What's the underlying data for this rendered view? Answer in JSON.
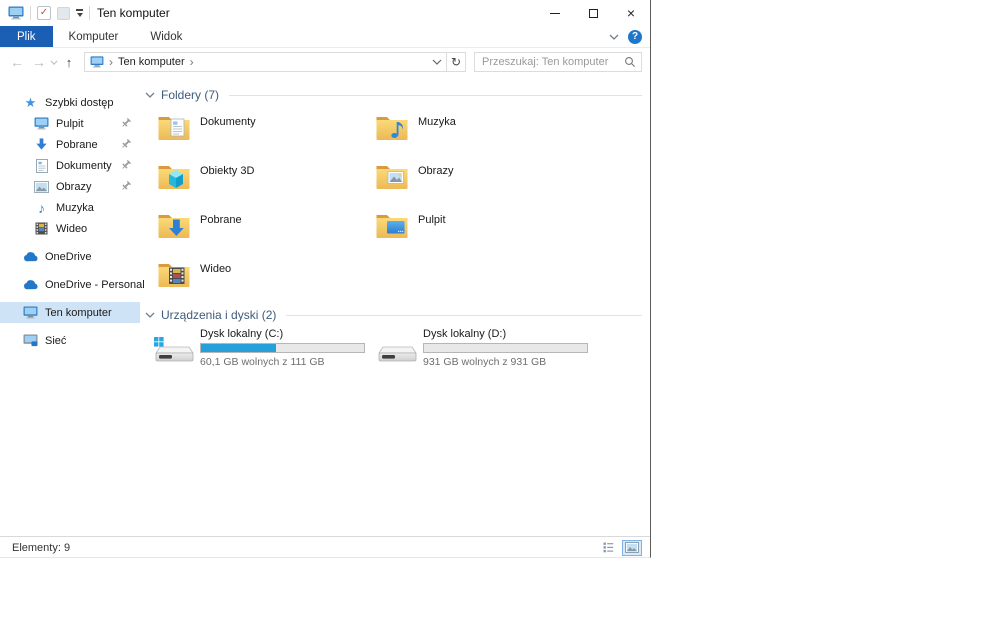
{
  "colors": {
    "accent": "#1b5fb5",
    "capacity_fill": "#26a0da",
    "selection_bg": "#cfe3f6"
  },
  "window": {
    "title": "Ten komputer"
  },
  "icons": {
    "back": "←",
    "forward": "→",
    "up": "↑",
    "refresh": "↻",
    "crumb_sep": "›",
    "help": "?",
    "close": "×",
    "star": "★",
    "music_note": "♪",
    "check": "✓"
  },
  "ribbon": {
    "tabs": [
      {
        "label": "Plik"
      },
      {
        "label": "Komputer"
      },
      {
        "label": "Widok"
      }
    ]
  },
  "address": {
    "path": "Ten komputer",
    "search_placeholder": "Przeszukaj: Ten komputer"
  },
  "sidebar": {
    "items": [
      {
        "label": "Szybki dostęp",
        "icon": "quick-access-star-icon"
      },
      {
        "label": "Pulpit",
        "icon": "desktop-monitor-icon",
        "pinned": true
      },
      {
        "label": "Pobrane",
        "icon": "downloads-arrow-icon",
        "pinned": true
      },
      {
        "label": "Dokumenty",
        "icon": "document-icon",
        "pinned": true
      },
      {
        "label": "Obrazy",
        "icon": "pictures-icon",
        "pinned": true
      },
      {
        "label": "Muzyka",
        "icon": "music-note-icon"
      },
      {
        "label": "Wideo",
        "icon": "video-filmstrip-icon"
      },
      {
        "label": "OneDrive",
        "icon": "onedrive-cloud-icon"
      },
      {
        "label": "OneDrive - Personal",
        "icon": "onedrive-cloud-icon"
      },
      {
        "label": "Ten komputer",
        "icon": "computer-monitor-icon",
        "selected": true
      },
      {
        "label": "Sieć",
        "icon": "network-icon"
      }
    ]
  },
  "main": {
    "folders": {
      "label": "Foldery (7)",
      "items": [
        {
          "name": "Dokumenty",
          "icon": "folder-documents-icon"
        },
        {
          "name": "Muzyka",
          "icon": "folder-music-icon"
        },
        {
          "name": "Obiekty 3D",
          "icon": "folder-3d-objects-icon"
        },
        {
          "name": "Obrazy",
          "icon": "folder-pictures-icon"
        },
        {
          "name": "Pobrane",
          "icon": "folder-downloads-icon"
        },
        {
          "name": "Pulpit",
          "icon": "folder-desktop-icon"
        },
        {
          "name": "Wideo",
          "icon": "folder-videos-icon"
        }
      ]
    },
    "drives": {
      "label": "Urządzenia i dyski (2)",
      "items": [
        {
          "name": "Dysk lokalny (C:)",
          "free": "60,1 GB wolnych z 111 GB",
          "used_pct": 46
        },
        {
          "name": "Dysk lokalny (D:)",
          "free": "931 GB wolnych z 931 GB",
          "used_pct": 0
        }
      ]
    }
  },
  "statusbar": {
    "items_label": "Elementy: 9"
  }
}
